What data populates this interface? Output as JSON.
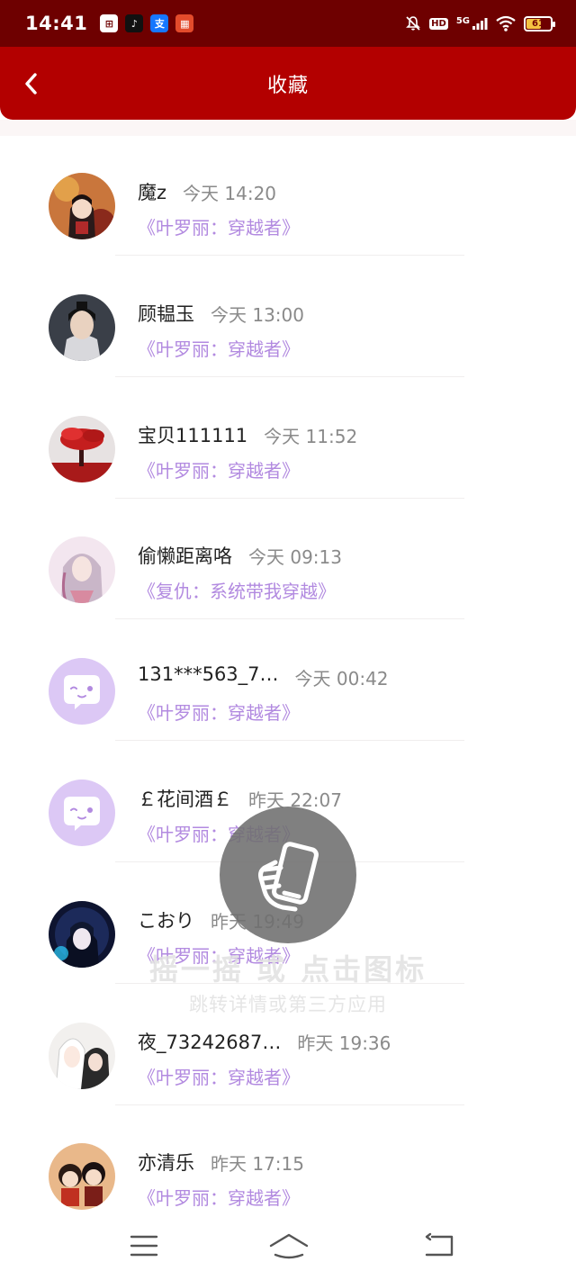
{
  "status_bar": {
    "time": "14:41",
    "network": "5G",
    "hd": "HD",
    "battery": "61",
    "battery_level": 0.61,
    "apps": [
      {
        "name": "tasks-app-icon",
        "glyph": "⊞",
        "bg": "#ffffff",
        "fg": "#6e0000"
      },
      {
        "name": "tiktok-app-icon",
        "glyph": "♪",
        "bg": "#111111",
        "fg": "#ffffff"
      },
      {
        "name": "alipay-app-icon",
        "glyph": "支",
        "bg": "#1677ff",
        "fg": "#ffffff"
      },
      {
        "name": "shop-app-icon",
        "glyph": "▦",
        "bg": "#e34b2b",
        "fg": "#ffffff"
      }
    ]
  },
  "header": {
    "title": "收藏",
    "color": "#b30000"
  },
  "items": [
    {
      "name": "魔z",
      "time": "今天 14:20",
      "book": "《叶罗丽：穿越者》",
      "avatar": "anime-girl-red"
    },
    {
      "name": "顾韫玉",
      "time": "今天 13:00",
      "book": "《叶罗丽：穿越者》",
      "avatar": "man-portrait"
    },
    {
      "name": "宝贝111111",
      "time": "今天 11:52",
      "book": "《叶罗丽：穿越者》",
      "avatar": "red-tree"
    },
    {
      "name": "偷懒距离咯",
      "time": "今天 09:13",
      "book": "《复仇：系统带我穿越》",
      "avatar": "anime-girl-pink"
    },
    {
      "name": "131***563_7…",
      "time": "今天 00:42",
      "book": "《叶罗丽：穿越者》",
      "avatar": "default-chat"
    },
    {
      "name": "￡花间酒￡",
      "time": "昨天 22:07",
      "book": "《叶罗丽：穿越者》",
      "avatar": "default-chat"
    },
    {
      "name": "こおり",
      "time": "昨天 19:49",
      "book": "《叶罗丽：穿越者》",
      "avatar": "anime-dark"
    },
    {
      "name": "夜_73242687…",
      "time": "昨天 19:36",
      "book": "《叶罗丽：穿越者》",
      "avatar": "anime-white-hair"
    },
    {
      "name": "亦清乐",
      "time": "昨天 17:15",
      "book": "《叶罗丽：穿越者》",
      "avatar": "chibi-pair"
    }
  ],
  "overlay": {
    "line1": "摇一摇 或 点击图标",
    "line2": "跳转详情或第三方应用"
  },
  "colors": {
    "accent_purple": "#b28ae0",
    "avatar_default_bg": "#dcc8f5"
  }
}
